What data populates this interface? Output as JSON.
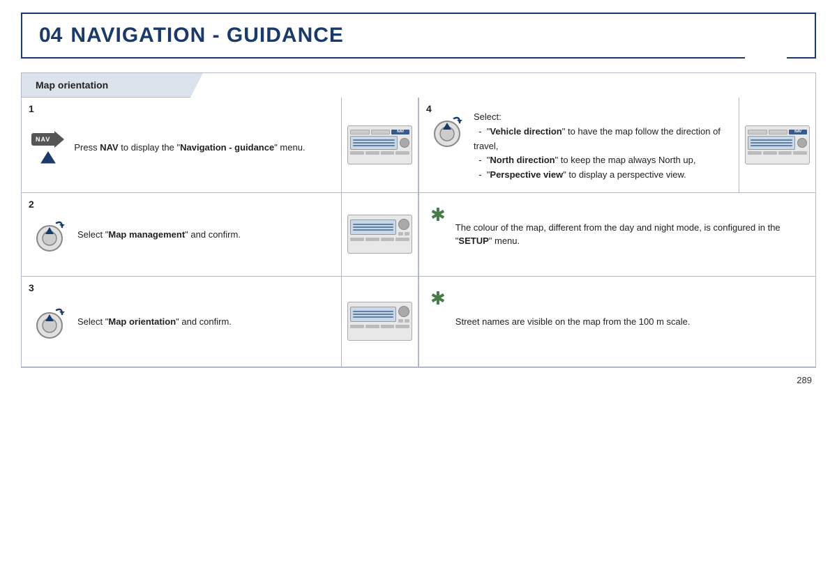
{
  "header": {
    "number": "04",
    "title": "NAVIGATION - GUIDANCE"
  },
  "section": {
    "title": "Map orientation"
  },
  "steps": [
    {
      "id": "1",
      "text_html": "Press <b>NAV</b> to display the \"<b>Navigation - guidance</b>\" menu.",
      "icon_type": "nav",
      "has_radio": true
    },
    {
      "id": "2",
      "text_html": "Select \"<b>Map management</b>\" and confirm.",
      "icon_type": "rotary",
      "has_radio": true
    },
    {
      "id": "3",
      "text_html": "Select \"<b>Map orientation</b>\" and confirm.",
      "icon_type": "rotary",
      "has_radio": true
    }
  ],
  "right_cells": [
    {
      "id": "4",
      "icon_type": "rotary_select",
      "text_intro": "Select:",
      "items": [
        {
          "bold": "\"Vehicle direction\"",
          "rest": " to have the map follow the direction of travel,"
        },
        {
          "bold": "\"North direction\"",
          "rest": " to keep the map always North up,"
        },
        {
          "bold": "\"Perspective view\"",
          "rest": " to display a perspective view."
        }
      ],
      "has_radio": true
    },
    {
      "id": "note1",
      "icon_type": "star",
      "text_html": "The colour of the map, different from the day and night mode, is configured in the \"<b>SETUP</b>\" menu.",
      "has_radio": false
    },
    {
      "id": "note2",
      "icon_type": "star",
      "text_html": "Street names are visible on the map from the 100 m scale.",
      "has_radio": false
    }
  ],
  "page_number": "289"
}
